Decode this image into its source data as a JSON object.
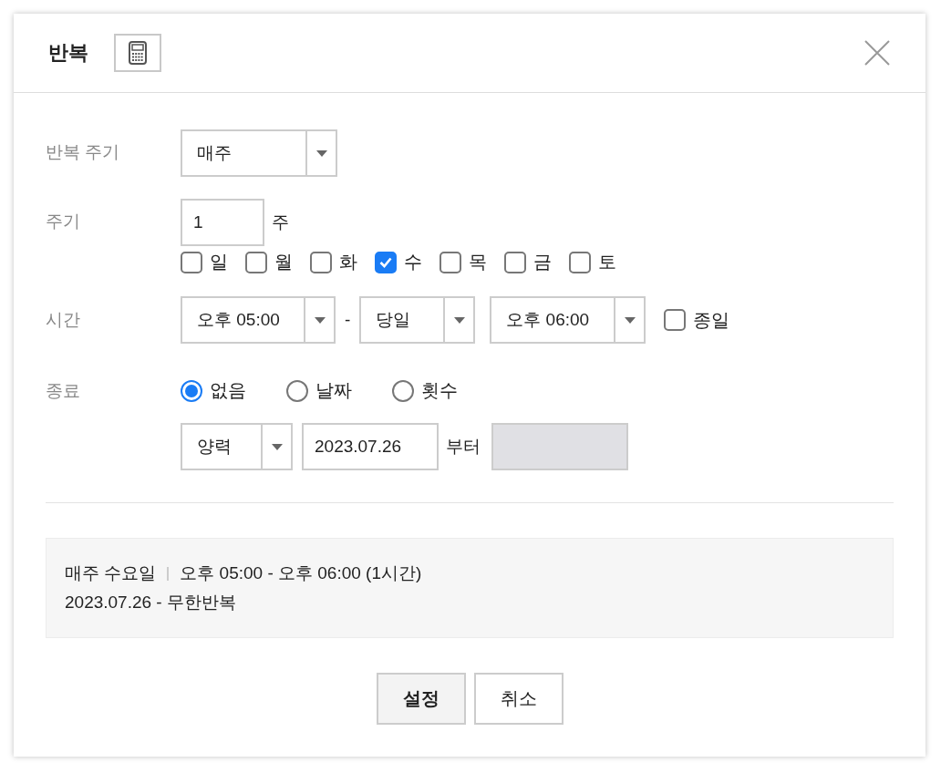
{
  "dialog": {
    "title": "반복"
  },
  "repeat_cycle": {
    "label": "반복 주기",
    "value": "매주"
  },
  "cycle": {
    "label": "주기",
    "value": "1",
    "unit": "주",
    "days": [
      {
        "label": "일",
        "checked": false
      },
      {
        "label": "월",
        "checked": false
      },
      {
        "label": "화",
        "checked": false
      },
      {
        "label": "수",
        "checked": true
      },
      {
        "label": "목",
        "checked": false
      },
      {
        "label": "금",
        "checked": false
      },
      {
        "label": "토",
        "checked": false
      }
    ]
  },
  "time": {
    "label": "시간",
    "start": "오후 05:00",
    "separator": "-",
    "day": "당일",
    "end": "오후 06:00",
    "all_day": {
      "label": "종일",
      "checked": false
    }
  },
  "end": {
    "label": "종료",
    "options": [
      {
        "label": "없음",
        "selected": true
      },
      {
        "label": "날짜",
        "selected": false
      },
      {
        "label": "횟수",
        "selected": false
      }
    ],
    "calendar": "양력",
    "start_date": "2023.07.26",
    "suffix": "부터",
    "end_field": {
      "disabled": true
    }
  },
  "summary": {
    "pattern": "매주 수요일",
    "time_range": "오후 05:00 - 오후 06:00 (1시간)",
    "date_range": "2023.07.26 - 무한반복"
  },
  "buttons": [
    {
      "label": "설정",
      "kind": "primary"
    },
    {
      "label": "취소",
      "kind": "secondary"
    }
  ]
}
